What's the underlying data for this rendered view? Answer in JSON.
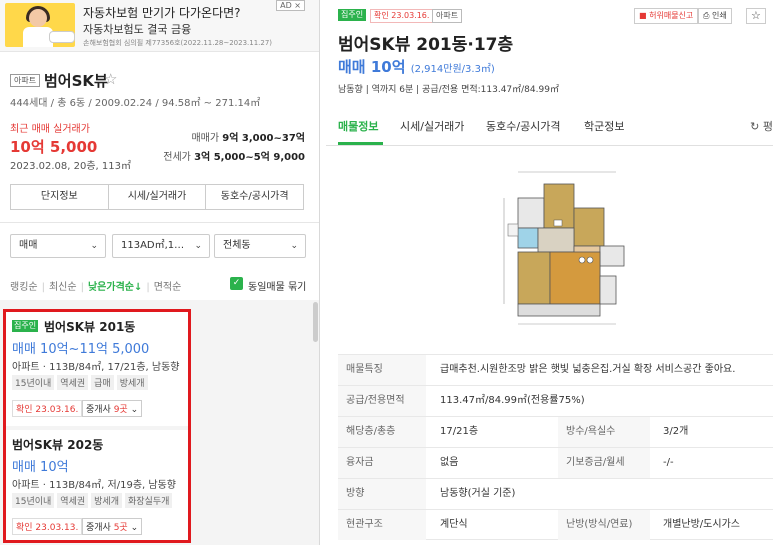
{
  "ad": {
    "title": "자동차보험 만기가 다가온다면?",
    "subtitle": "자동차보험도 결국 금융",
    "fine": "손해보험협회 심의필 제77356호(2022.11.28~2023.11.27)",
    "badge": "AD ×"
  },
  "complex": {
    "type_tag": "아파트",
    "name": "범어SK뷰",
    "star": "☆",
    "info": "444세대 / 총 6동 / 2009.02.24 / 94.58㎡ ~ 271.14㎡",
    "recent_label": "최근 매매 실거래가",
    "recent_price": "10억 5,000",
    "recent_date": "2023.02.08, 20층, 113㎡",
    "sale_label": "매매가",
    "sale_value": "9억 3,000~37억",
    "jeonse_label": "전세가",
    "jeonse_value": "3억 5,000~5억 9,000"
  },
  "left_tabs": [
    "단지정보",
    "시세/실거래가",
    "동호수/공시가격"
  ],
  "filters": {
    "trade": "매매",
    "area": "113AD㎡,1…",
    "dong": "전체동",
    "chevron": "⌄"
  },
  "sort": {
    "items": [
      "랭킹순",
      "최신순",
      "낮은가격순↓",
      "면적순"
    ],
    "sep": "|",
    "check_mark": "✓",
    "same_listing": "동일매물 묶기"
  },
  "listings": [
    {
      "badge": "집주인",
      "name": "범어SK뷰 201동",
      "price": "매매 10억~11억 5,000",
      "desc": "아파트 · 113B/84㎡, 17/21층, 남동향",
      "tags": [
        "15년이내",
        "역세권",
        "급매",
        "방세개"
      ],
      "confirm": "확인 23.03.16.",
      "agents_prefix": "중개사 ",
      "agents_count": "9곳",
      "agents_suffix": " ⌄"
    },
    {
      "badge": "",
      "name": "범어SK뷰 202동",
      "price": "매매 10억",
      "desc": "아파트 · 113B/84㎡, 저/19층, 남동향",
      "tags": [
        "15년이내",
        "역세권",
        "방세개",
        "화장실두개"
      ],
      "confirm": "확인 23.03.13.",
      "agents_prefix": "중개사 ",
      "agents_count": "5곳",
      "agents_suffix": " ⌄"
    }
  ],
  "detail": {
    "badge_owner": "집주인",
    "badge_confirm": "확인 23.03.16.",
    "badge_type": "아파트",
    "report": "허위매물신고",
    "print": "인쇄",
    "star": "☆",
    "title": "범어SK뷰 201동·17층",
    "price": "매매 10억",
    "price_sub": "(2,914만원/3.3㎡)",
    "info": "남동향 | 역까지 6분 | 공급/전용 면적:113.47㎡/84.99㎡",
    "tabs": [
      "매물정보",
      "시세/실거래가",
      "동호수/공시가격",
      "학군정보"
    ],
    "refresh": "↻ 평",
    "table": [
      {
        "label": "매물특징",
        "value": "급매추천.시원한조망 밝은 햇빛 넓충은집.거실 확장 서비스공간 좋아요.",
        "label2": "",
        "value2": ""
      },
      {
        "label": "공급/전용면적",
        "value": "113.47㎡/84.99㎡(전용률75%)",
        "label2": "",
        "value2": ""
      },
      {
        "label": "해당층/총층",
        "value": "17/21층",
        "label2": "방수/욕실수",
        "value2": "3/2개"
      },
      {
        "label": "융자금",
        "value": "없음",
        "label2": "기보증금/월세",
        "value2": "-/-"
      },
      {
        "label": "방향",
        "value": "남동향(거실 기준)",
        "label2": "",
        "value2": ""
      },
      {
        "label": "현관구조",
        "value": "계단식",
        "label2": "난방(방식/연료)",
        "value2": "개별난방/도시가스"
      }
    ]
  },
  "colors": {
    "green": "#2bb24c",
    "red": "#e53935",
    "blue": "#3f7ad9",
    "highlight": "#e0191e"
  }
}
